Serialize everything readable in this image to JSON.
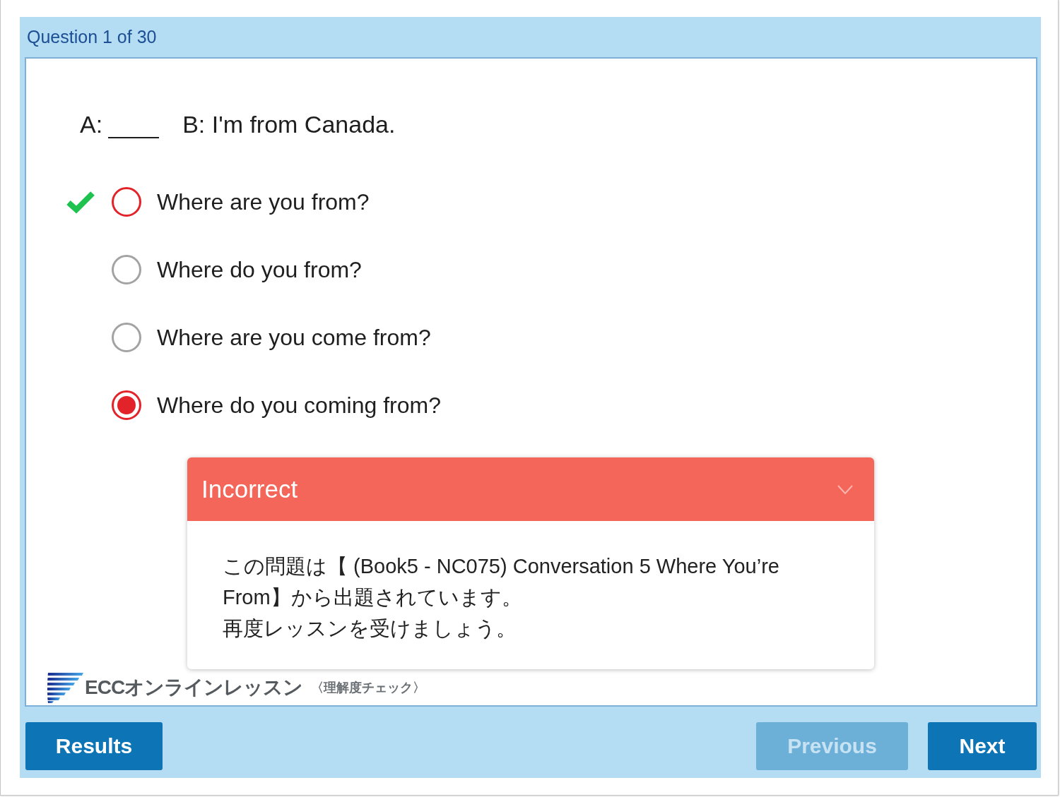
{
  "header": {
    "counter": "Question 1 of 30"
  },
  "question": {
    "parts": [
      {
        "kind": "text",
        "text": "A:"
      },
      {
        "kind": "blank"
      },
      {
        "kind": "text",
        "text": "B: I'm from Canada."
      }
    ]
  },
  "options": [
    {
      "text": "Where are you from?",
      "selected": false,
      "correct": true
    },
    {
      "text": "Where do you from?",
      "selected": false,
      "correct": false
    },
    {
      "text": "Where are you come from?",
      "selected": false,
      "correct": false
    },
    {
      "text": "Where do you coming from?",
      "selected": true,
      "correct": false
    }
  ],
  "feedback": {
    "correct": false,
    "title": "Incorrect",
    "expanded": true,
    "paragraphs": [
      "この問題は【 (Book5 - NC075) Conversation 5 Where You’re From】から出題されています。",
      "再度レッスンを受けましょう。"
    ]
  },
  "logo": {
    "name": "ECCオンラインレッスン",
    "tagline": "〈理解度チェック〉"
  },
  "footer": {
    "left_buttons": [
      {
        "label": "Results",
        "disabled": false
      }
    ],
    "right_buttons": [
      {
        "label": "Previous",
        "disabled": true
      },
      {
        "label": "Next",
        "disabled": false
      }
    ]
  }
}
